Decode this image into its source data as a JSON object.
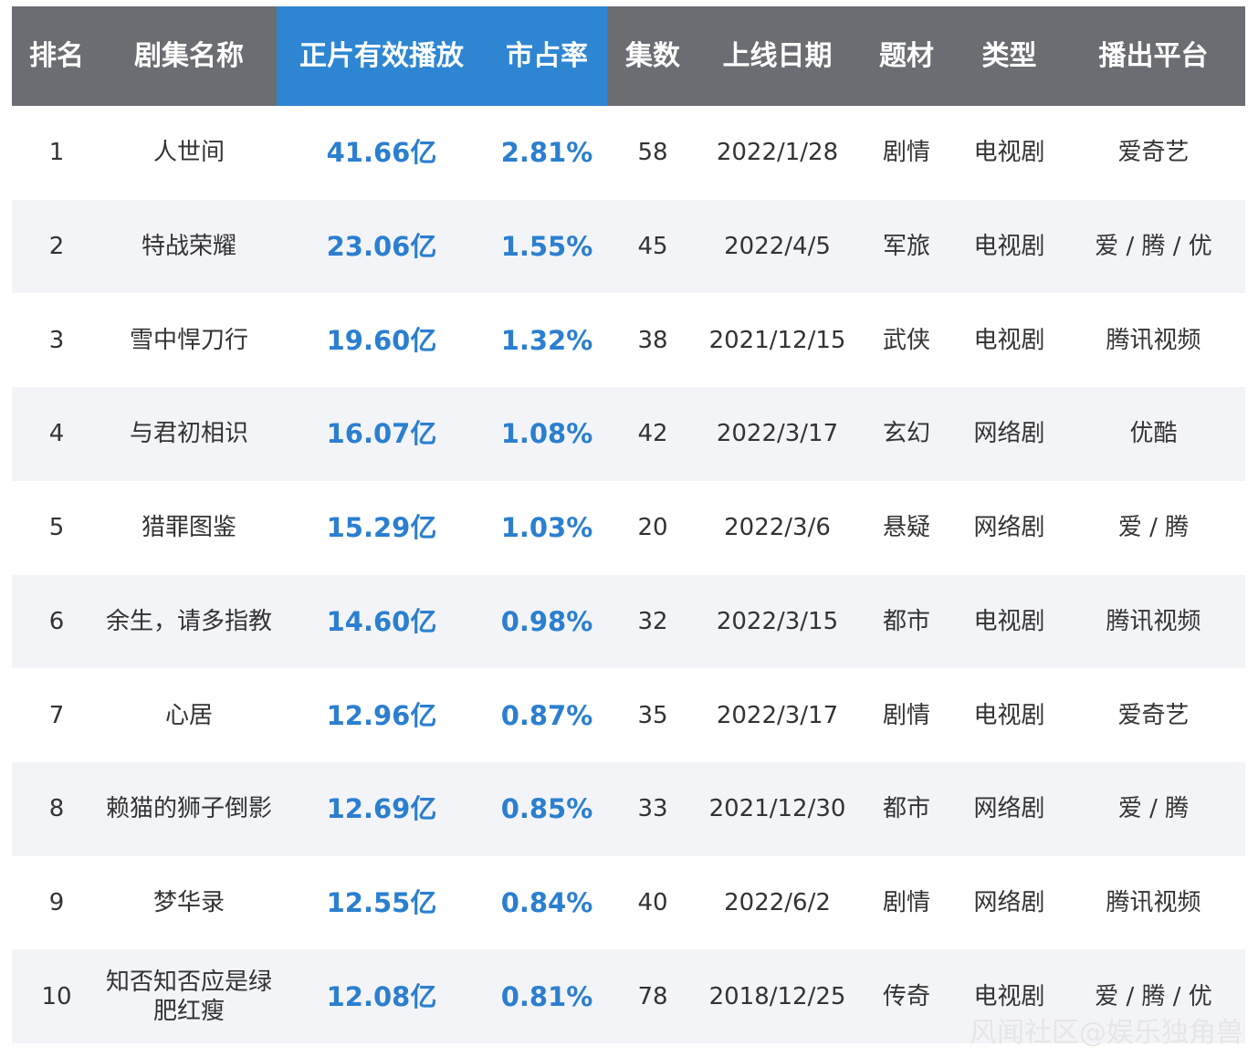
{
  "chart_data": {
    "type": "table",
    "columns": [
      "排名",
      "剧集名称",
      "正片有效播放",
      "市占率",
      "集数",
      "上线日期",
      "题材",
      "类型",
      "播出平台"
    ],
    "rows": [
      [
        "1",
        "人世间",
        "41.66亿",
        "2.81%",
        "58",
        "2022/1/28",
        "剧情",
        "电视剧",
        "爱奇艺"
      ],
      [
        "2",
        "特战荣耀",
        "23.06亿",
        "1.55%",
        "45",
        "2022/4/5",
        "军旅",
        "电视剧",
        "爱 / 腾 / 优"
      ],
      [
        "3",
        "雪中悍刀行",
        "19.60亿",
        "1.32%",
        "38",
        "2021/12/15",
        "武侠",
        "电视剧",
        "腾讯视频"
      ],
      [
        "4",
        "与君初相识",
        "16.07亿",
        "1.08%",
        "42",
        "2022/3/17",
        "玄幻",
        "网络剧",
        "优酷"
      ],
      [
        "5",
        "猎罪图鉴",
        "15.29亿",
        "1.03%",
        "20",
        "2022/3/6",
        "悬疑",
        "网络剧",
        "爱 / 腾"
      ],
      [
        "6",
        "余生，请多指教",
        "14.60亿",
        "0.98%",
        "32",
        "2022/3/15",
        "都市",
        "电视剧",
        "腾讯视频"
      ],
      [
        "7",
        "心居",
        "12.96亿",
        "0.87%",
        "35",
        "2022/3/17",
        "剧情",
        "电视剧",
        "爱奇艺"
      ],
      [
        "8",
        "赖猫的狮子倒影",
        "12.69亿",
        "0.85%",
        "33",
        "2021/12/30",
        "都市",
        "网络剧",
        "爱 / 腾"
      ],
      [
        "9",
        "梦华录",
        "12.55亿",
        "0.84%",
        "40",
        "2022/6/2",
        "剧情",
        "网络剧",
        "腾讯视频"
      ],
      [
        "10",
        "知否知否应是绿肥红瘦",
        "12.08亿",
        "0.81%",
        "78",
        "2018/12/25",
        "传奇",
        "电视剧",
        "爱 / 腾 / 优"
      ]
    ],
    "highlight_columns": [
      "正片有效播放",
      "市占率"
    ]
  },
  "colors": {
    "header_bg": "#6b6d72",
    "header_highlight_bg": "#2e86d3",
    "header_text": "#ffffff",
    "highlight_value_text": "#2b7fd0",
    "body_text": "#333333",
    "row_alt_bg": "#f3f4f7"
  },
  "watermark": "风闻社区@娱乐独角兽"
}
